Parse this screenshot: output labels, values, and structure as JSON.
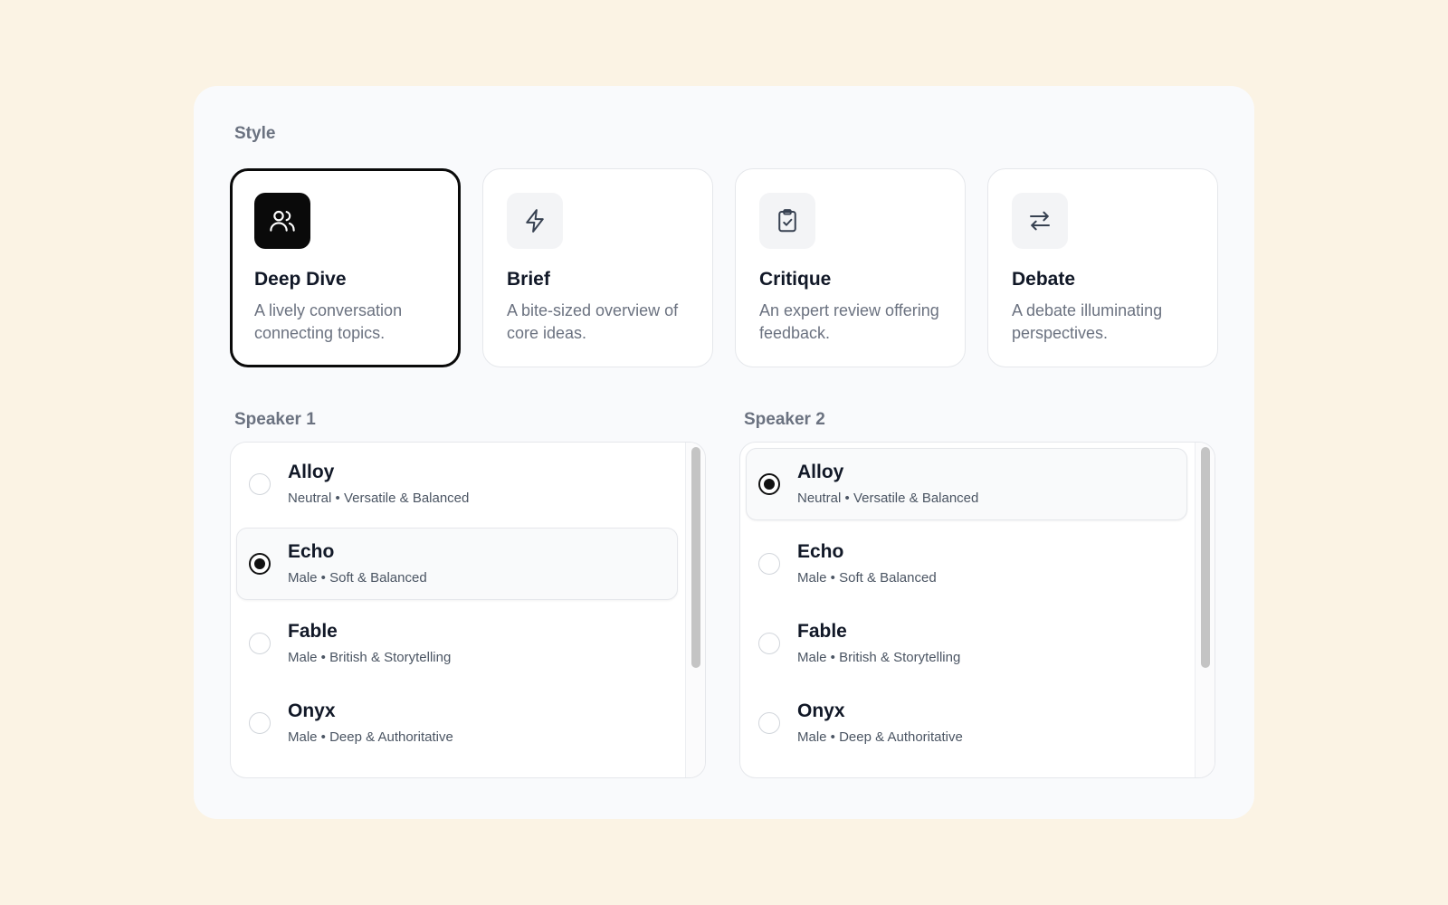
{
  "style": {
    "label": "Style",
    "cards": [
      {
        "title": "Deep Dive",
        "description": "A lively conversation connecting topics.",
        "icon": "users-icon",
        "selected": true
      },
      {
        "title": "Brief",
        "description": "A bite-sized overview of core ideas.",
        "icon": "lightning-icon",
        "selected": false
      },
      {
        "title": "Critique",
        "description": "An expert review offering feedback.",
        "icon": "clipboard-check-icon",
        "selected": false
      },
      {
        "title": "Debate",
        "description": "A debate illuminating perspectives.",
        "icon": "arrows-swap-icon",
        "selected": false
      }
    ]
  },
  "speaker1": {
    "label": "Speaker 1",
    "selected": "Echo",
    "voices": [
      {
        "name": "Alloy",
        "meta": "Neutral • Versatile & Balanced"
      },
      {
        "name": "Echo",
        "meta": "Male • Soft & Balanced"
      },
      {
        "name": "Fable",
        "meta": "Male • British & Storytelling"
      },
      {
        "name": "Onyx",
        "meta": "Male • Deep & Authoritative"
      }
    ]
  },
  "speaker2": {
    "label": "Speaker 2",
    "selected": "Alloy",
    "voices": [
      {
        "name": "Alloy",
        "meta": "Neutral • Versatile & Balanced"
      },
      {
        "name": "Echo",
        "meta": "Male • Soft & Balanced"
      },
      {
        "name": "Fable",
        "meta": "Male • British & Storytelling"
      },
      {
        "name": "Onyx",
        "meta": "Male • Deep & Authoritative"
      }
    ]
  },
  "colors": {
    "page_background": "#fbf3e4",
    "panel_background": "#f9fafc",
    "accent": "#0a0a0a"
  }
}
